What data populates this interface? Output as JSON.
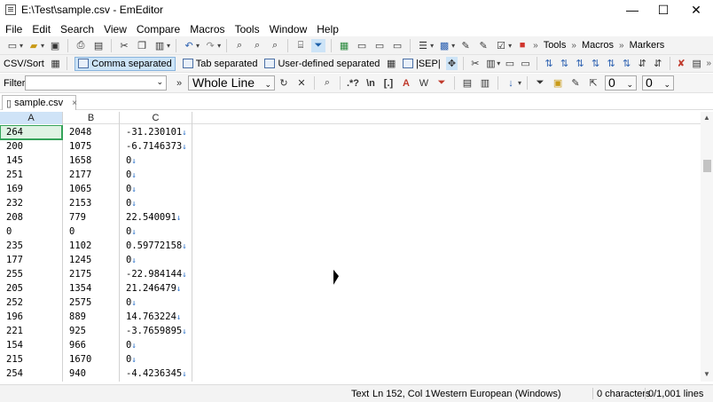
{
  "window": {
    "title": "E:\\Test\\sample.csv - EmEditor",
    "minimize": "—",
    "maximize": "☐",
    "close": "✕"
  },
  "menu": [
    "File",
    "Edit",
    "Search",
    "View",
    "Compare",
    "Macros",
    "Tools",
    "Window",
    "Help"
  ],
  "toolbar": {
    "tools_label": "Tools",
    "macros_label": "Macros",
    "markers_label": "Markers"
  },
  "csvbar": {
    "label": "CSV/Sort",
    "comma": "Comma separated",
    "tab": "Tab separated",
    "user": "User-defined separated",
    "sep": "|SEP|"
  },
  "filterbar": {
    "label": "Filter",
    "filter_value": "",
    "mode": "Whole Line",
    "num1": "0",
    "num2": "0"
  },
  "tab": {
    "name": "sample.csv",
    "close": "×"
  },
  "columns": [
    "A",
    "B",
    "C"
  ],
  "rows": [
    [
      "264",
      "2048",
      "-31.230101"
    ],
    [
      "200",
      "1075",
      "-6.7146373"
    ],
    [
      "145",
      "1658",
      "0"
    ],
    [
      "251",
      "2177",
      "0"
    ],
    [
      "169",
      "1065",
      "0"
    ],
    [
      "232",
      "2153",
      "0"
    ],
    [
      "208",
      "779",
      "22.540091"
    ],
    [
      "0",
      "0",
      "0"
    ],
    [
      "235",
      "1102",
      "0.59772158"
    ],
    [
      "177",
      "1245",
      "0"
    ],
    [
      "255",
      "2175",
      "-22.984144"
    ],
    [
      "205",
      "1354",
      "21.246479"
    ],
    [
      "252",
      "2575",
      "0"
    ],
    [
      "196",
      "889",
      "14.763224"
    ],
    [
      "221",
      "925",
      "-3.7659895"
    ],
    [
      "154",
      "966",
      "0"
    ],
    [
      "215",
      "1670",
      "0"
    ],
    [
      "254",
      "940",
      "-4.4236345"
    ]
  ],
  "status": {
    "mode": "Text",
    "position": "Ln 152, Col 1",
    "encoding": "Western European (Windows)",
    "chars": "0 characters",
    "lines": "0/1,001 lines"
  }
}
